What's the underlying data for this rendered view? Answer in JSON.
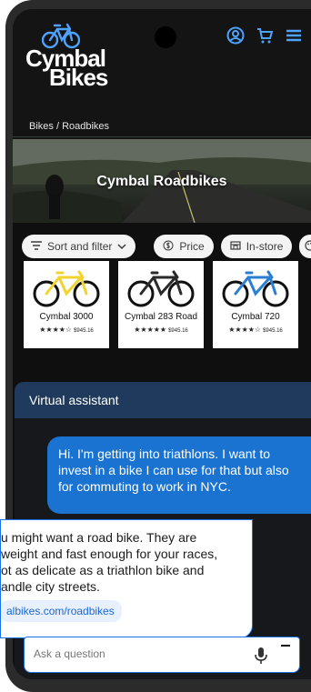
{
  "brand": {
    "line1": "Cymbal",
    "line2": "Bikes"
  },
  "breadcrumb": "Bikes / Roadbikes",
  "hero": {
    "title": "Cymbal Roadbikes"
  },
  "filters": {
    "sort": "Sort and filter",
    "price": "Price",
    "instore": "In-store"
  },
  "products": [
    {
      "name": "Cymbal 3000",
      "stars": "★★★★☆",
      "price": "$945.16",
      "color": "#f1d431"
    },
    {
      "name": "Cymbal 283 Road",
      "stars": "★★★★★",
      "price": "$945.16",
      "color": "#2a2a2a"
    },
    {
      "name": "Cymbal 720",
      "stars": "★★★★☆",
      "price": "$945.16",
      "color": "#2b7fd3"
    }
  ],
  "assistant": {
    "title": "Virtual assistant",
    "user_message": "Hi. I'm getting into triathlons. I want to invest in a bike I can use for that but also for commuting to work in NYC.",
    "bot_message": "u might want a road bike. They are\nweight and fast enough for your races,\not as delicate as a triathlon bike and\nandle city streets.",
    "bot_link": "albikes.com/roadbikes",
    "input_placeholder": "Ask a question"
  },
  "colors": {
    "accent": "#1a73e8",
    "header": "#1f3a5c",
    "brand_icon": "#4da3ff"
  },
  "icons": [
    "account-icon",
    "cart-icon",
    "menu-icon",
    "sort-icon",
    "chevron-down-icon",
    "price-icon",
    "store-icon",
    "mic-icon",
    "minimize-icon"
  ]
}
